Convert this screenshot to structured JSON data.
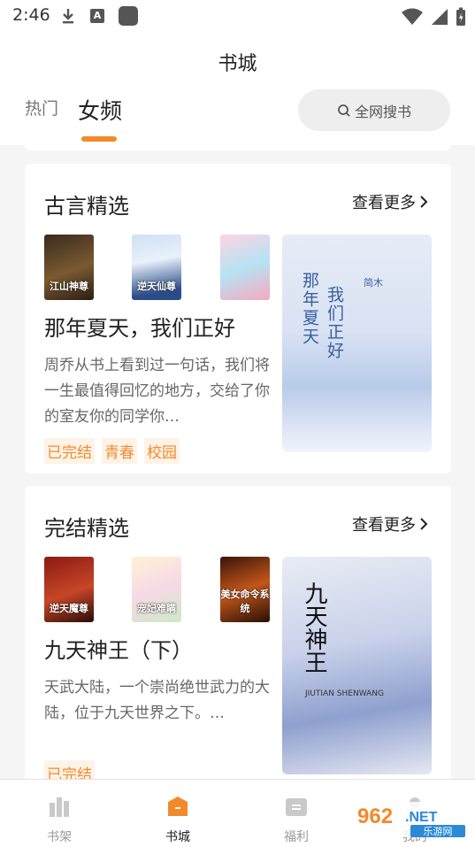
{
  "status_bar": {
    "time": "2:46",
    "a_icon_letter": "A"
  },
  "header": {
    "title": "书城",
    "tabs": [
      {
        "label": "热门",
        "active": false
      },
      {
        "label": "女频",
        "active": true
      }
    ],
    "search_label": "全网搜书"
  },
  "sections": [
    {
      "title": "古言精选",
      "more_label": "查看更多",
      "thumbs": [
        {
          "text": "江山神尊"
        },
        {
          "text": "逆天仙尊"
        },
        {
          "text": ""
        }
      ],
      "book": {
        "name": "那年夏天，我们正好",
        "desc": "周乔从书上看到过一句话，我们将一生最值得回忆的地方，交给了你的室友你的同学你…",
        "tags": [
          "已完结",
          "青春",
          "校园"
        ]
      },
      "cover": {
        "title_a": "那年夏天",
        "title_b": "我们正好",
        "author": "简木"
      }
    },
    {
      "title": "完结精选",
      "more_label": "查看更多",
      "thumbs": [
        {
          "text": "逆天魔尊"
        },
        {
          "text": "宠妃难瞒"
        },
        {
          "text": "美女命令系统"
        }
      ],
      "book": {
        "name": "九天神王（下）",
        "desc": "天武大陆，一个崇尚绝世武力的大陆，位于九天世界之下。…",
        "tags": [
          "已完结"
        ]
      },
      "cover": {
        "title": "九天神王",
        "subtitle": "JIUTIAN SHENWANG"
      }
    }
  ],
  "bottom_nav": [
    {
      "label": "书架",
      "icon": "bookshelf-icon",
      "active": false
    },
    {
      "label": "书城",
      "icon": "bookstore-icon",
      "active": true
    },
    {
      "label": "福利",
      "icon": "welfare-icon",
      "active": false
    },
    {
      "label": "我的",
      "icon": "profile-icon",
      "active": false
    }
  ],
  "watermark": {
    "text": "962.NET",
    "sub": "乐游网"
  },
  "colors": {
    "accent": "#f28a2b",
    "tag_bg": "#fff3e8",
    "nav_active": "#f28a2b"
  }
}
